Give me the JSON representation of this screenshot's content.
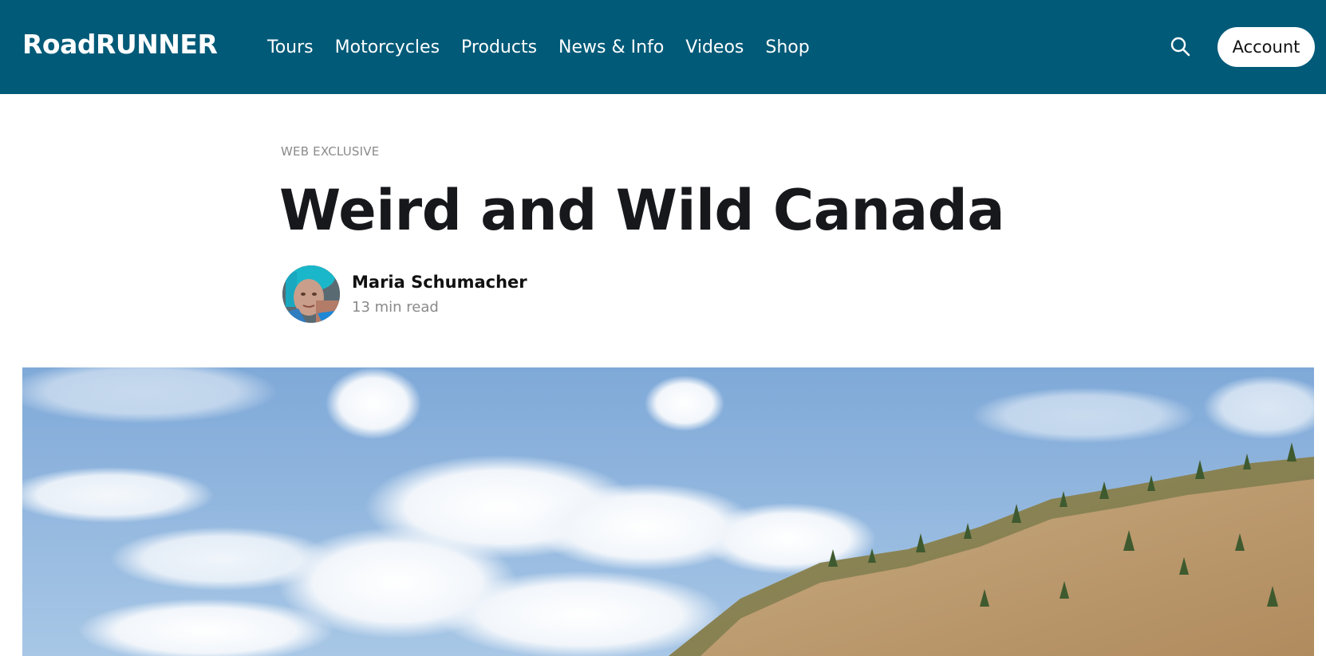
{
  "header": {
    "logo_text": "RoadRUNNER",
    "nav": [
      {
        "label": "Tours"
      },
      {
        "label": "Motorcycles"
      },
      {
        "label": "Products"
      },
      {
        "label": "News & Info"
      },
      {
        "label": "Videos"
      },
      {
        "label": "Shop"
      }
    ],
    "search_icon": "search-icon",
    "account_label": "Account",
    "background_color": "#005a78"
  },
  "article": {
    "category": "WEB EXCLUSIVE",
    "title": "Weird and Wild Canada",
    "author": "Maria Schumacher",
    "read_time": "13 min read",
    "hero_image": "hero-image"
  }
}
